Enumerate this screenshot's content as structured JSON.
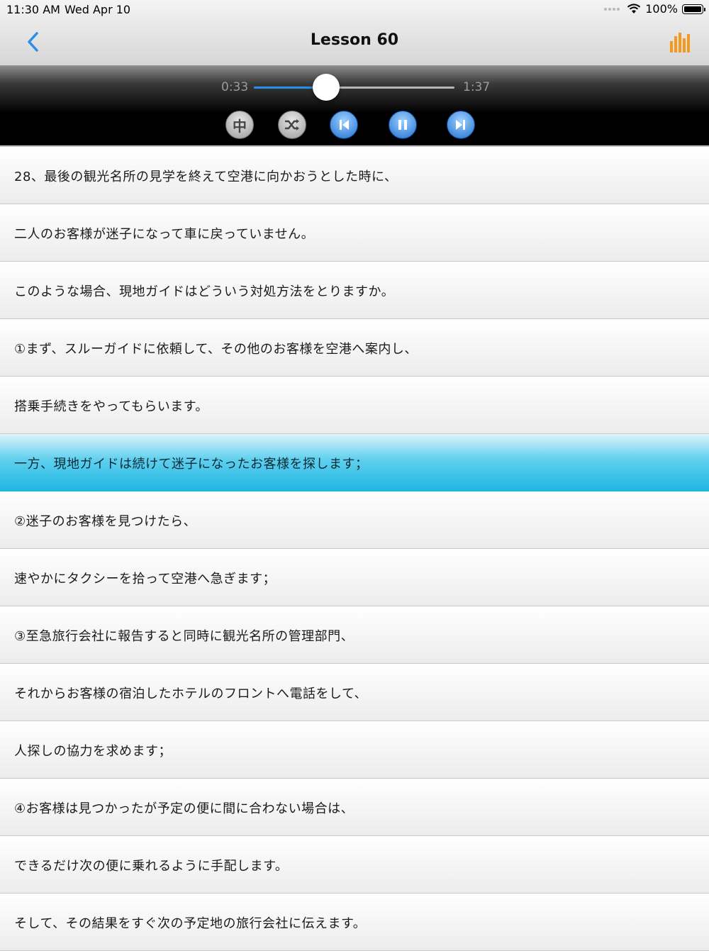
{
  "status_bar": {
    "time": "11:30 AM",
    "date": "Wed Apr 10",
    "battery": "100%"
  },
  "nav": {
    "title": "Lesson 60",
    "back_icon": "chevron-left-icon",
    "chart_icon": "bar-chart-icon"
  },
  "player": {
    "current_time": "0:33",
    "total_time": "1:37",
    "progress": 0.36,
    "lang_button_label": "中",
    "controls": [
      "language-toggle",
      "shuffle",
      "previous",
      "pause",
      "next"
    ]
  },
  "colors": {
    "accent_blue": "#2a8ee8",
    "highlight_cyan": "#1fb6e3",
    "chart_orange": "#f39a1e"
  },
  "lines": [
    "28、最後の観光名所の見学を終えて空港に向かおうとした時に、",
    "二人のお客様が迷子になって車に戻っていません。",
    "このような場合、現地ガイドはどういう対処方法をとりますか。",
    "①まず、スルーガイドに依頼して、その他のお客様を空港へ案内し、",
    "搭乗手続きをやってもらいます。",
    "一方、現地ガイドは続けて迷子になったお客様を探します；",
    "②迷子のお客様を見つけたら、",
    "速やかにタクシーを拾って空港へ急ぎます；",
    "③至急旅行会社に報告すると同時に観光名所の管理部門、",
    "それからお客様の宿泊したホテルのフロントへ電話をして、",
    "人探しの協力を求めます；",
    "④お客様は見つかったが予定の便に間に合わない場合は、",
    "できるだけ次の便に乗れるように手配します。",
    "そして、その結果をすぐ次の予定地の旅行会社に伝えます。"
  ],
  "active_line_index": 5
}
